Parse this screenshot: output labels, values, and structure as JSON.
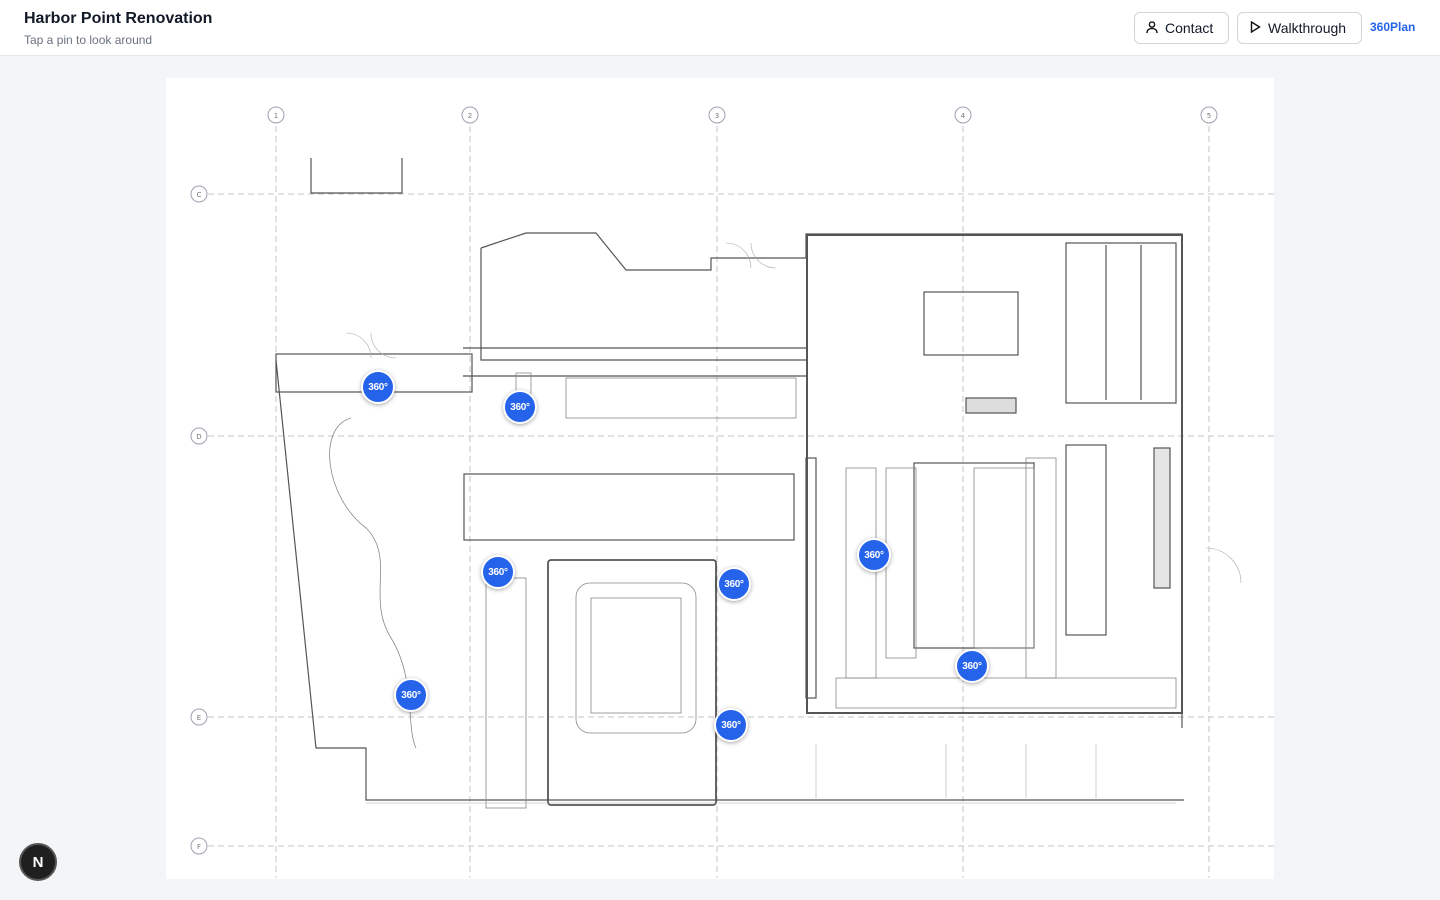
{
  "header": {
    "title": "Harbor Point Renovation",
    "subtitle": "Tap a pin to look around",
    "contact_label": "Contact",
    "walkthrough_label": "Walkthrough",
    "brand": "360Plan"
  },
  "pins": [
    {
      "label": "360°"
    },
    {
      "label": "360°"
    },
    {
      "label": "360°"
    },
    {
      "label": "360°"
    },
    {
      "label": "360°"
    },
    {
      "label": "360°"
    },
    {
      "label": "360°"
    },
    {
      "label": "360°"
    }
  ],
  "grid": {
    "columns": [
      "1",
      "2",
      "3",
      "4",
      "5"
    ],
    "rows": [
      "C",
      "D",
      "E",
      "F"
    ]
  },
  "badge": {
    "letter": "N"
  },
  "colors": {
    "accent": "#2563eb",
    "pin": "#2563eb"
  }
}
